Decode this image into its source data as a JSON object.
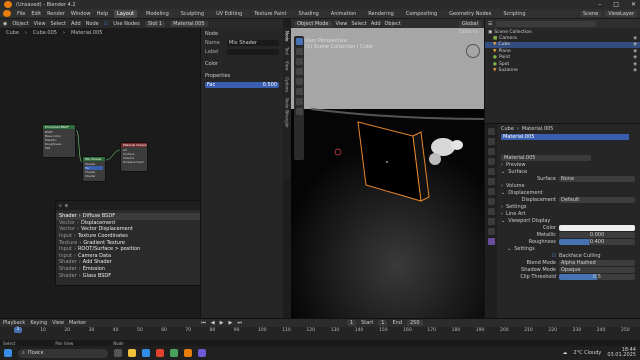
{
  "title": "(Unsaved) - Blender 4.2",
  "window_controls": [
    "–",
    "□",
    "✕"
  ],
  "menu": [
    "File",
    "Edit",
    "Render",
    "Window",
    "Help"
  ],
  "workspaces": [
    "Layout",
    "Modeling",
    "Sculpting",
    "UV Editing",
    "Texture Paint",
    "Shading",
    "Animation",
    "Rendering",
    "Compositing",
    "Geometry Nodes",
    "Scripting"
  ],
  "scene": "Scene",
  "view_layer": "ViewLayer",
  "node_editor": {
    "header": [
      "Object",
      "View",
      "Select",
      "Add",
      "Node"
    ],
    "use_nodes": "Use Nodes",
    "slot": "Slot 1",
    "material": "Material.005",
    "breadcrumb": [
      "Cube",
      "Cube.005",
      "Material.005"
    ]
  },
  "npanel": {
    "section": "Node",
    "name_label": "Name",
    "name_value": "Mix Shader",
    "label_label": "Label",
    "color_section": "Color",
    "properties_section": "Properties",
    "fac_label": "Fac",
    "fac_value": "0.500",
    "tabs": [
      "Node",
      "Tool",
      "View",
      "Options",
      "Node Wrangler"
    ]
  },
  "nodes": [
    {
      "title": "Principled BSDF",
      "rows": [
        "BSDF",
        "Base Color",
        "Metallic",
        "Roughness",
        "IOR",
        "Alpha",
        "Normal"
      ]
    },
    {
      "title": "Mix Shader",
      "rows": [
        "Shader",
        "Fac",
        "Shader",
        "Shader"
      ]
    },
    {
      "title": "Material Output",
      "rows": [
        "All",
        "Surface",
        "Volume",
        "Displacement",
        "Thickness"
      ]
    }
  ],
  "search": {
    "query": "e",
    "items": [
      {
        "cat": "Shader",
        "name": "Diffuse BSDF",
        "selected": true
      },
      {
        "cat": "Vector",
        "name": "Displacement"
      },
      {
        "cat": "Vector",
        "name": "Vector Displacement"
      },
      {
        "cat": "Input",
        "name": "Texture Coordinates"
      },
      {
        "cat": "Texture",
        "name": "Gradient Texture"
      },
      {
        "cat": "Input",
        "name": "ROOT/Surface > position"
      },
      {
        "cat": "Input",
        "name": "Camera Data"
      },
      {
        "cat": "Shader",
        "name": "Add Shader"
      },
      {
        "cat": "Shader",
        "name": "Emission"
      },
      {
        "cat": "Shader",
        "name": "Glass BSDF"
      }
    ]
  },
  "viewport": {
    "header": [
      "Object Mode",
      "View",
      "Select",
      "Add",
      "Object"
    ],
    "global": "Global",
    "options": "Options",
    "perspective": "User Perspective",
    "collection": "(1) Scene Collection | Cube"
  },
  "outliner": {
    "root": "Scene Collection",
    "items": [
      {
        "name": "Camera",
        "icon_color": "#7fb24a"
      },
      {
        "name": "Cube",
        "icon_color": "#e8a13a",
        "selected": true
      },
      {
        "name": "Plane",
        "icon_color": "#e8a13a"
      },
      {
        "name": "Point",
        "icon_color": "#7fb24a"
      },
      {
        "name": "Spot",
        "icon_color": "#7fb24a"
      },
      {
        "name": "Suzanne",
        "icon_color": "#e8a13a"
      }
    ]
  },
  "properties": {
    "breadcrumb": [
      "Cube",
      "Material.005"
    ],
    "slot": "Material.005",
    "datablock": "Material.005",
    "sections": {
      "preview": "Preview",
      "surface": "Surface",
      "surface_label": "Surface",
      "surface_value": "None",
      "volume": "Volume",
      "displacement": "Displacement",
      "displacement_label": "Displacement",
      "displacement_value": "Default",
      "settings": "Settings",
      "line_art": "Line Art",
      "viewport_display": "Viewport Display",
      "color_label": "Color",
      "metallic_label": "Metallic",
      "metallic_value": "0.000",
      "roughness_label": "Roughness",
      "roughness_value": "0.400",
      "settings2": "Settings",
      "backface": "Backface Culling",
      "blend_label": "Blend Mode",
      "blend_value": "Alpha Hashed",
      "shadow_label": "Shadow Mode",
      "shadow_value": "Opaque",
      "clip_label": "Clip Threshold",
      "clip_value": "0.5"
    }
  },
  "timeline": {
    "header": [
      "Playback",
      "Keying",
      "View",
      "Marker"
    ],
    "current": "1",
    "start_label": "Start",
    "start": "1",
    "end_label": "End",
    "end": "250",
    "ticks": [
      "0",
      "10",
      "20",
      "30",
      "40",
      "50",
      "60",
      "70",
      "80",
      "90",
      "100",
      "110",
      "120",
      "130",
      "140",
      "150",
      "160",
      "170",
      "180",
      "190",
      "200",
      "210",
      "220",
      "230",
      "240",
      "250"
    ]
  },
  "statusbar": [
    "Select",
    "Pan View",
    "Node"
  ],
  "taskbar": {
    "search": "Поиск",
    "weather": "2°C Cloudy",
    "time": "18:44",
    "date": "03.01.2025"
  },
  "colors": {
    "accent": "#4772b3",
    "selection": "#e8872a",
    "orange_logo": "#e87d0d"
  }
}
